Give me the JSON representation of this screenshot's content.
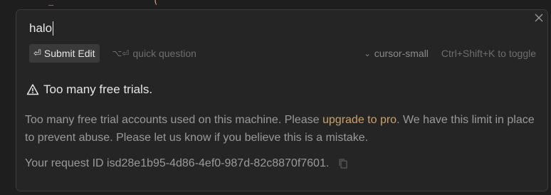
{
  "prompt": {
    "value": "halo"
  },
  "toolbar": {
    "submit_glyph": "⏎",
    "submit_label": "Submit Edit",
    "quick_glyph": "⌥⏎",
    "quick_label": "quick question",
    "model_chevron": "⌄",
    "model_label": "cursor-small",
    "toggle_hint": "Ctrl+Shift+K to toggle"
  },
  "error": {
    "title": "Too many free trials.",
    "body_before": "Too many free trial accounts used on this machine. Please ",
    "link": "upgrade to pro",
    "body_after": ". We have this limit in place to prevent abuse. Please let us know if you believe this is a mistake.",
    "request_prefix": "Your request ID is ",
    "request_id": "d28e1b95-4d86-4ef0-987d-82c8870f7601",
    "request_suffix": "."
  },
  "colors": {
    "panel_bg": "#252526",
    "link": "#c9a26a",
    "muted_text": "#9a9a9a"
  },
  "icons": {
    "close": "close-icon",
    "warning": "warning-icon",
    "copy": "copy-icon"
  }
}
